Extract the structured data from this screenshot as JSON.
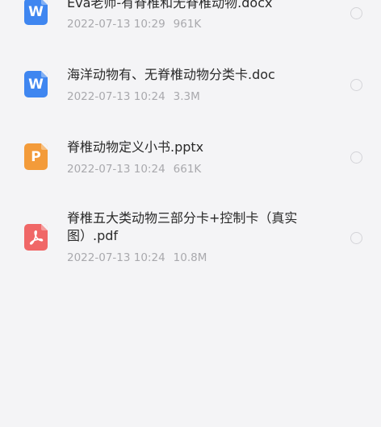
{
  "files": [
    {
      "name": "Eva老师-有脊椎和无脊椎动物.docx",
      "date": "2022-07-13 10:29",
      "size": "961K",
      "icon": "word-doc-icon",
      "icon_letter": "W",
      "color": "#3f86f0"
    },
    {
      "name": "海洋动物有、无脊椎动物分类卡.doc",
      "date": "2022-07-13 10:24",
      "size": "3.3M",
      "icon": "word-doc-icon",
      "icon_letter": "W",
      "color": "#3f86f0"
    },
    {
      "name": "脊椎动物定义小书.pptx",
      "date": "2022-07-13 10:24",
      "size": "661K",
      "icon": "ppt-doc-icon",
      "icon_letter": "P",
      "color": "#f39b3a"
    },
    {
      "name": "脊椎五大类动物三部分卡+控制卡（真实图）.pdf",
      "date": "2022-07-13 10:24",
      "size": "10.8M",
      "icon": "pdf-doc-icon",
      "icon_letter": "",
      "color": "#f06767"
    }
  ]
}
